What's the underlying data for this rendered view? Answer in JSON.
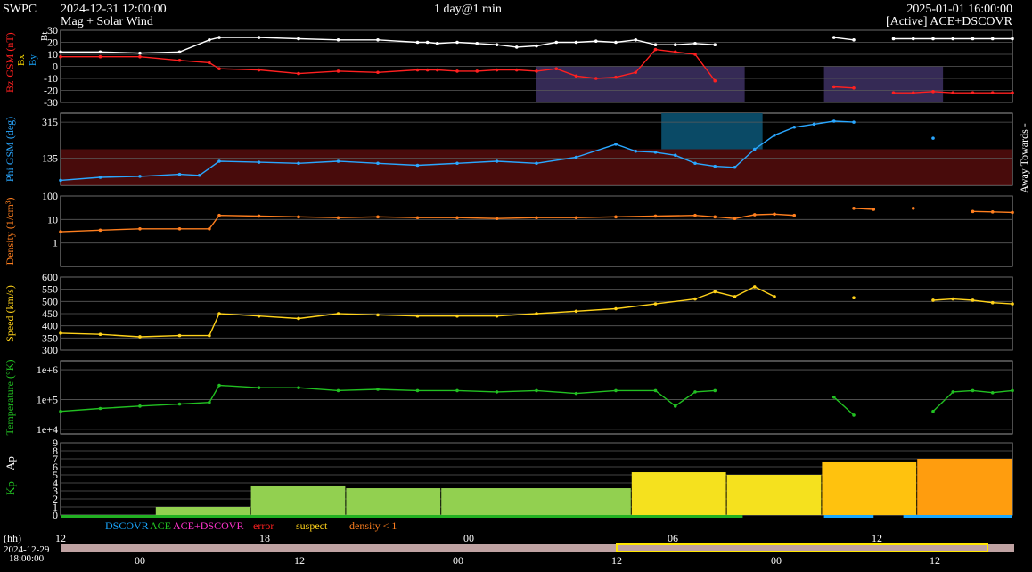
{
  "header": {
    "brand": "SWPC",
    "start_time": "2024-12-31 12:00:00",
    "subtitle": "Mag + Solar Wind",
    "span": "1 day@1 min",
    "end_time": "2025-01-01 16:00:00",
    "source": "[Active] ACE+DSCOVR"
  },
  "colors": {
    "bt": "#ffffff",
    "bz": "#ff2020",
    "bx": "#ffdd00",
    "by": "#19a7ff",
    "phi": "#2aa7ff",
    "density": "#ff7f1f",
    "speed": "#ffd21a",
    "temperature": "#22c022",
    "kp_label": "#22c022",
    "grid": "#5a5a5a",
    "away_fill": "#5a0e0e",
    "toward_fill": "#0a4a66",
    "south_fill": "#352a55",
    "status_ok": "#22b022",
    "status_dscovr": "#19a7ff"
  },
  "panels": [
    {
      "id": "mag",
      "ylabels": [
        "Bz",
        "GSM (nT)"
      ],
      "legend": [
        "Bx",
        "By",
        "Bt"
      ],
      "scale": "linear",
      "ticks": [
        "30",
        "20",
        "10",
        "0",
        "-10",
        "-20",
        "-30"
      ],
      "ylim": [
        -30,
        30
      ]
    },
    {
      "id": "phi",
      "ylabels": [
        "Phi GSM (deg)"
      ],
      "scale": "linear",
      "ticks": [
        "315",
        "135"
      ],
      "ylim": [
        0,
        360
      ],
      "side_label": "Away Towards -"
    },
    {
      "id": "density",
      "ylabels": [
        "Density (1/cm³)"
      ],
      "scale": "log",
      "ticks": [
        "100",
        "10",
        "1"
      ],
      "ylim": [
        0.1,
        100
      ]
    },
    {
      "id": "speed",
      "ylabels": [
        "Speed (km/s)"
      ],
      "scale": "linear",
      "ticks": [
        "600",
        "550",
        "500",
        "450",
        "400",
        "350",
        "300"
      ],
      "ylim": [
        300,
        600
      ]
    },
    {
      "id": "temperature",
      "ylabels": [
        "Temperature (°K)"
      ],
      "scale": "log",
      "ticks": [
        "1e+6",
        "1e+5",
        "1e+4"
      ],
      "ylim": [
        7000,
        2000000
      ]
    },
    {
      "id": "kp",
      "ylabels": [
        "Kp",
        "Ap"
      ],
      "scale": "linear",
      "ticks": [
        "9",
        "8",
        "7",
        "6",
        "5",
        "4",
        "3",
        "2",
        "1",
        "0"
      ],
      "ylim": [
        0,
        9
      ]
    }
  ],
  "status_legend": [
    {
      "label": "DSCOVR",
      "color": "#19a7ff"
    },
    {
      "label": "ACE",
      "color": "#22c022"
    },
    {
      "label": "ACE+DSCOVR",
      "color": "#ff33cc"
    },
    {
      "label": "error",
      "color": "#ff2020"
    },
    {
      "label": "suspect",
      "color": "#ffd21a"
    },
    {
      "label": "density < 1",
      "color": "#ff7f1f"
    }
  ],
  "time_axis": {
    "unit_label": "(hh)",
    "top_ticks": [
      "12",
      "18",
      "00",
      "06",
      "12"
    ],
    "bottom_date": "2024-12-29",
    "bottom_time": "18:00:00",
    "bottom_ticks": [
      "00",
      "12",
      "00",
      "12",
      "00",
      "12"
    ]
  },
  "chart_data": {
    "type": "line",
    "x_hours": "hours after 2024-12-31 12:00",
    "series": [
      {
        "name": "Bt",
        "panel": "mag",
        "x": [
          0,
          2,
          4,
          6,
          7.5,
          8,
          10,
          12,
          14,
          16,
          18,
          18.5,
          19,
          20,
          21,
          22,
          23,
          24,
          25,
          26,
          27,
          28,
          29,
          30,
          31,
          32,
          33,
          34,
          35,
          36,
          37,
          38,
          39,
          40,
          41,
          42,
          43,
          44,
          45,
          46,
          47,
          48
        ],
        "y": [
          12,
          12,
          11,
          12,
          22,
          24,
          24,
          23,
          22,
          22,
          20,
          20,
          19,
          20,
          19,
          18,
          16,
          17,
          20,
          20,
          21,
          20,
          22,
          18,
          18,
          19,
          18,
          null,
          null,
          null,
          null,
          null,
          24,
          22,
          null,
          23,
          23,
          23,
          23,
          23,
          23,
          23
        ]
      },
      {
        "name": "Bz",
        "panel": "mag",
        "x": [
          0,
          2,
          4,
          6,
          7.5,
          8,
          10,
          12,
          14,
          16,
          18,
          18.5,
          19,
          20,
          21,
          22,
          23,
          24,
          25,
          26,
          27,
          28,
          29,
          30,
          31,
          32,
          33,
          34,
          35,
          36,
          37,
          38,
          39,
          40,
          41,
          42,
          43,
          44,
          45,
          46,
          47,
          48
        ],
        "y": [
          8,
          8,
          8,
          5,
          3,
          -2,
          -3,
          -6,
          -4,
          -5,
          -3,
          -3,
          -3,
          -4,
          -4,
          -3,
          -3,
          -4,
          -2,
          -8,
          -10,
          -9,
          -5,
          14,
          12,
          10,
          -12,
          null,
          null,
          null,
          null,
          null,
          -17,
          -18,
          null,
          -22,
          -22,
          -21,
          -22,
          -22,
          -22,
          -22
        ]
      },
      {
        "name": "Phi",
        "panel": "phi",
        "x": [
          0,
          2,
          4,
          6,
          7,
          8,
          10,
          12,
          14,
          16,
          18,
          20,
          22,
          24,
          26,
          28,
          29,
          30,
          31,
          32,
          33,
          34,
          35,
          36,
          37,
          38,
          39,
          40,
          41,
          42,
          43,
          44,
          45,
          46,
          47,
          48
        ],
        "y": [
          25,
          40,
          45,
          55,
          50,
          120,
          115,
          110,
          120,
          110,
          100,
          110,
          120,
          110,
          140,
          205,
          170,
          165,
          150,
          110,
          95,
          90,
          180,
          250,
          290,
          305,
          320,
          315,
          null,
          null,
          null,
          235,
          null,
          null,
          null,
          null
        ]
      },
      {
        "name": "Density",
        "panel": "density",
        "x": [
          0,
          2,
          4,
          6,
          7.5,
          8,
          10,
          12,
          14,
          16,
          18,
          20,
          22,
          24,
          26,
          28,
          30,
          32,
          33,
          34,
          35,
          36,
          37,
          38,
          39,
          40,
          41,
          42,
          43,
          44,
          45,
          46,
          47,
          48
        ],
        "y": [
          3,
          3.5,
          4,
          4,
          4,
          15,
          14,
          13,
          12,
          13,
          12,
          12,
          11,
          12,
          12,
          13,
          14,
          15,
          13,
          11,
          16,
          17,
          15,
          null,
          null,
          30,
          27,
          null,
          30,
          null,
          null,
          22,
          21,
          20
        ]
      },
      {
        "name": "Speed",
        "panel": "speed",
        "x": [
          0,
          2,
          4,
          6,
          7.5,
          8,
          10,
          12,
          14,
          16,
          18,
          20,
          22,
          24,
          26,
          28,
          30,
          32,
          33,
          34,
          35,
          36,
          37,
          38,
          39,
          40,
          41,
          42,
          43,
          44,
          45,
          46,
          47,
          48
        ],
        "y": [
          370,
          365,
          355,
          360,
          360,
          450,
          440,
          430,
          450,
          445,
          440,
          440,
          440,
          450,
          460,
          470,
          490,
          510,
          540,
          520,
          560,
          520,
          null,
          null,
          null,
          515,
          null,
          null,
          null,
          505,
          510,
          505,
          495,
          490
        ]
      },
      {
        "name": "Temperature",
        "panel": "temperature",
        "x": [
          0,
          2,
          4,
          6,
          7.5,
          8,
          10,
          12,
          14,
          16,
          18,
          20,
          22,
          24,
          26,
          28,
          30,
          31,
          32,
          33,
          34,
          35,
          36,
          37,
          38,
          39,
          40,
          41,
          42,
          43,
          44,
          45,
          46,
          47,
          48
        ],
        "y": [
          40000,
          50000,
          60000,
          70000,
          80000,
          300000,
          250000,
          250000,
          200000,
          220000,
          200000,
          200000,
          180000,
          200000,
          160000,
          200000,
          200000,
          60000,
          180000,
          200000,
          null,
          null,
          null,
          null,
          null,
          120000,
          30000,
          null,
          null,
          null,
          40000,
          180000,
          200000,
          170000,
          200000
        ]
      }
    ],
    "kp_bars": {
      "start_hours": [
        0,
        3,
        6,
        9,
        12,
        15,
        18,
        21,
        24
      ],
      "values": [
        1,
        3.67,
        3.33,
        3.33,
        3.33,
        5.33,
        5,
        6.67,
        7
      ],
      "colors": [
        "#92d050",
        "#92d050",
        "#92d050",
        "#92d050",
        "#92d050",
        "#f5e11e",
        "#f5e11e",
        "#ffc20e",
        "#ff9d0e"
      ]
    },
    "kp_range_hours": [
      -3,
      27
    ],
    "range_hours": [
      0,
      48
    ]
  }
}
